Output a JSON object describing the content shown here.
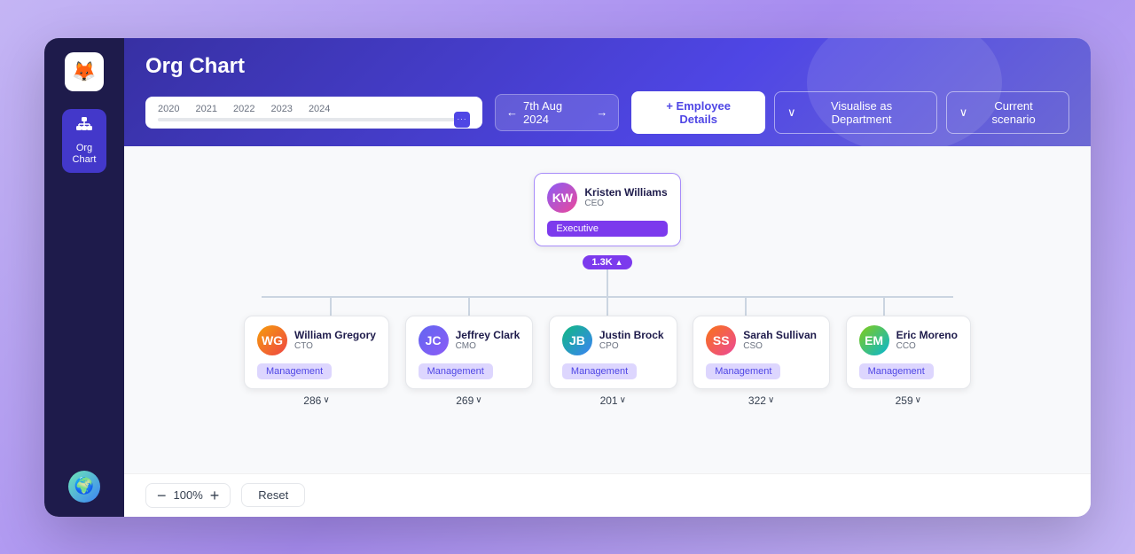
{
  "app": {
    "title": "Org Chart",
    "sidebar": {
      "logo": "🦊",
      "nav_items": [
        {
          "id": "org-chart",
          "icon": "⬛",
          "label": "Org\nChart",
          "active": true
        }
      ],
      "user_avatar": "🌍"
    }
  },
  "header": {
    "title": "Org Chart",
    "timeline": {
      "years": [
        "2020",
        "2021",
        "2022",
        "2023",
        "2024"
      ]
    },
    "date_selector": {
      "arrow_left": "←",
      "value": "7th Aug 2024",
      "arrow_right": "→"
    },
    "buttons": {
      "employee_details": "+ Employee Details",
      "visualise": "Visualise as Department",
      "current_scenario": "Current scenario"
    }
  },
  "org_chart": {
    "ceo": {
      "name": "Kristen Williams",
      "role": "CEO",
      "badge": "Executive",
      "count": "1.3K",
      "avatar_initials": "KW"
    },
    "reports": [
      {
        "name": "William Gregory",
        "role": "CTO",
        "badge": "Management",
        "count": "286",
        "avatar_initials": "WG"
      },
      {
        "name": "Jeffrey Clark",
        "role": "CMO",
        "badge": "Management",
        "count": "269",
        "avatar_initials": "JC"
      },
      {
        "name": "Justin Brock",
        "role": "CPO",
        "badge": "Management",
        "count": "201",
        "avatar_initials": "JB"
      },
      {
        "name": "Sarah Sullivan",
        "role": "CSO",
        "badge": "Management",
        "count": "322",
        "avatar_initials": "SS"
      },
      {
        "name": "Eric Moreno",
        "role": "CCO",
        "badge": "Management",
        "count": "259",
        "avatar_initials": "EM"
      }
    ]
  },
  "footer": {
    "zoom_minus": "−",
    "zoom_value": "100%",
    "zoom_plus": "+",
    "reset_label": "Reset"
  }
}
